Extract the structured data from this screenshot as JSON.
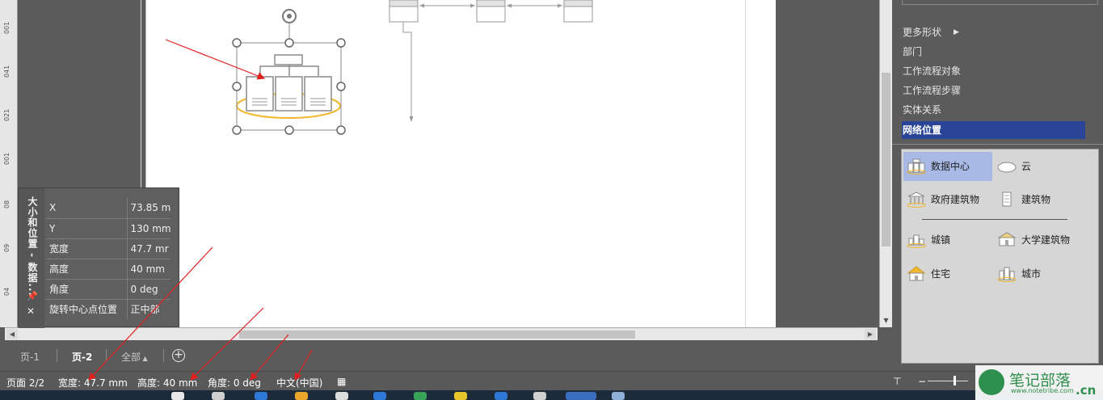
{
  "ruler": {
    "labels": [
      "001",
      "041",
      "021",
      "001",
      "08",
      "09",
      "04"
    ]
  },
  "size_position_panel": {
    "title": "大小和位置 - 数据...",
    "rows": [
      {
        "key": "X",
        "value": "73.85 m"
      },
      {
        "key": "Y",
        "value": "130 mm"
      },
      {
        "key": "宽度",
        "value": "47.7 mr"
      },
      {
        "key": "高度",
        "value": "40 mm"
      },
      {
        "key": "角度",
        "value": "0 deg"
      },
      {
        "key": "旋转中心点位置",
        "value": "正中部"
      }
    ]
  },
  "page_tabs": {
    "tab1": "页-1",
    "tab2": "页-2",
    "all": "全部"
  },
  "shape_categories": {
    "items": [
      {
        "label": "更多形状"
      },
      {
        "label": "部门"
      },
      {
        "label": "工作流程对象"
      },
      {
        "label": "工作流程步骤"
      },
      {
        "label": "实体关系"
      },
      {
        "label": "网络位置"
      }
    ]
  },
  "stencil": {
    "items": [
      {
        "label": "数据中心",
        "icon": "datacenter-icon",
        "selected": true
      },
      {
        "label": "云",
        "icon": "cloud-icon"
      },
      {
        "label": "政府建筑物",
        "icon": "government-building-icon"
      },
      {
        "label": "建筑物",
        "icon": "building-icon"
      },
      {
        "label": "城镇",
        "icon": "town-icon"
      },
      {
        "label": "大学建筑物",
        "icon": "university-icon"
      },
      {
        "label": "住宅",
        "icon": "house-icon"
      },
      {
        "label": "城市",
        "icon": "city-icon"
      }
    ]
  },
  "status_bar": {
    "page": "页面 2/2",
    "width": "宽度: 47.7 mm",
    "height": "高度: 40 mm",
    "angle": "角度: 0 deg",
    "language": "中文(中国)"
  },
  "watermark": {
    "name": "笔记部落",
    "url": "www.notetribe.com",
    "suffix": ".cn"
  },
  "colors": {
    "selected_category": "#2a4597",
    "annotation_arrow": "#e02020",
    "selection_ellipse": "#f2b82e"
  }
}
